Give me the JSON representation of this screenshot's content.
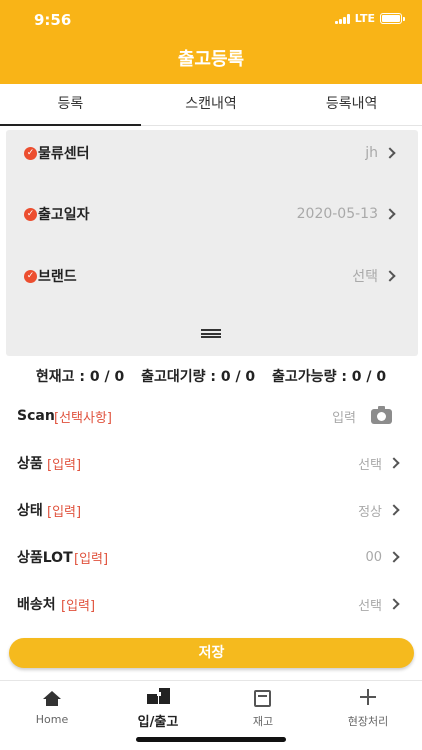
{
  "status_bar": {
    "time": "9:56",
    "network": "LTE"
  },
  "nav": {
    "title": "출고등록"
  },
  "tabs": [
    {
      "label": "등록"
    },
    {
      "label": "스캔내역"
    },
    {
      "label": "등록내역"
    }
  ],
  "panel": {
    "rows": [
      {
        "label": "물류센터",
        "value": "jh"
      },
      {
        "label": "출고일자",
        "value": "2020-05-13"
      },
      {
        "label": "브랜드",
        "value": "선택"
      }
    ]
  },
  "stock": {
    "current": "현재고 : 0 / 0",
    "waiting": "출고대기량 : 0 / 0",
    "available": "출고가능량 : 0 / 0"
  },
  "form": {
    "scan": {
      "label": "Scan",
      "tag": "[선택사항]",
      "value": "입력"
    },
    "product": {
      "label": "상품",
      "tag": "[입력]",
      "value": "선택"
    },
    "state": {
      "label": "상태",
      "tag": "[입력]",
      "value": "정상"
    },
    "lot": {
      "label": "상품LOT",
      "tag": "[입력]",
      "value": "00"
    },
    "delivery": {
      "label": "배송처",
      "tag": "[입력]",
      "value": "선택"
    }
  },
  "save_label": "저장",
  "bottom_tabs": [
    {
      "label": "Home",
      "icon": "home-icon"
    },
    {
      "label": "입/출고",
      "icon": "inout-icon"
    },
    {
      "label": "재고",
      "icon": "stock-icon"
    },
    {
      "label": "현장처리",
      "icon": "plus-icon"
    }
  ],
  "colors": {
    "accent": "#f9b417",
    "required": "#ec4e2f",
    "tag": "#e0533e"
  }
}
